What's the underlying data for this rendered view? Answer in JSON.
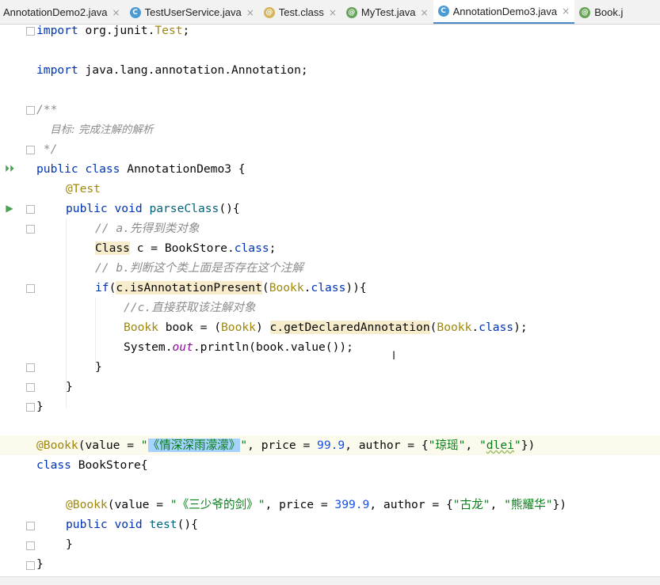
{
  "tabs": [
    {
      "label": "AnnotationDemo2.java",
      "icon": "none",
      "active": false
    },
    {
      "label": "TestUserService.java",
      "icon": "class-icon",
      "active": false
    },
    {
      "label": "Test.class",
      "icon": "annotation-icon",
      "active": false
    },
    {
      "label": "MyTest.java",
      "icon": "annotation-icon",
      "active": false
    },
    {
      "label": "AnnotationDemo3.java",
      "icon": "class-icon",
      "active": true
    },
    {
      "label": "Book.j",
      "icon": "annotation-icon",
      "active": false
    }
  ],
  "close_glyph": "×",
  "code": {
    "l1_kw": "import",
    "l1_rest": " org.junit.",
    "l1_cls": "Test",
    "l1_end": ";",
    "l3_kw": "import",
    "l3_rest": " java.lang.annotation.Annotation;",
    "l5": "/**",
    "l6": "    目标: 完成注解的解析",
    "l7": " */",
    "l8_kw": "public class",
    "l8_rest": " AnnotationDemo3 {",
    "l9": "@Test",
    "l10_kw": "public void",
    "l10_fn": " parseClass",
    "l10_end": "(){",
    "l11": "// a.先得到类对象",
    "l12_a": "Class",
    "l12_b": " c = BookStore.",
    "l12_c": "class",
    "l12_d": ";",
    "l13": "// b.判断这个类上面是否存在这个注解",
    "l14_kw": "if",
    "l14_a": "(",
    "l14_b": "c.isAnnotationPresent",
    "l14_c": "(",
    "l14_d": "Bookk",
    "l14_e": ".",
    "l14_f": "class",
    "l14_g": ")){",
    "l15": "//c.直接获取该注解对象",
    "l16_a": "Bookk",
    "l16_b": " book = (",
    "l16_c": "Bookk",
    "l16_d": ") ",
    "l16_e": "c.getDeclaredAnnotation",
    "l16_f": "(",
    "l16_g": "Bookk",
    "l16_h": ".",
    "l16_i": "class",
    "l16_j": ");",
    "l17_a": "System.",
    "l17_b": "out",
    "l17_c": ".println(book.value());",
    "l18": "}",
    "l19": "}",
    "l20": "}",
    "l22_an": "@Bookk",
    "l22_a": "(value = ",
    "l22_s1": "\"",
    "l22_sel": "《情深深雨濛濛》",
    "l22_s2": "\"",
    "l22_b": ", price = ",
    "l22_num": "99.9",
    "l22_c": ", author = {",
    "l22_s3": "\"琼瑶\"",
    "l22_d": ", ",
    "l22_s4a": "\"",
    "l22_s4b": "dlei",
    "l22_s4c": "\"",
    "l22_e": "})",
    "l23_kw": "class",
    "l23_rest": " BookStore{",
    "l25_an": "@Bookk",
    "l25_a": "(value = ",
    "l25_s1": "\"《三少爷的剑》\"",
    "l25_b": ", price = ",
    "l25_num": "399.9",
    "l25_c": ", author = {",
    "l25_s2": "\"古龙\"",
    "l25_d": ", ",
    "l25_s3": "\"熊耀华\"",
    "l25_e": "})",
    "l26_kw": "public void",
    "l26_fn": " test",
    "l26_end": "(){",
    "l27": "}",
    "l28": "}"
  },
  "gutter": {
    "run_class_glyph": "⏵⏵",
    "run_method_glyph": "▶"
  },
  "cursor_glyph": "I",
  "colors": {
    "keyword": "#0033b3",
    "comment": "#8c8c8c",
    "annotation": "#9e880d",
    "string": "#067d17",
    "number": "#1750eb",
    "selection": "#a6d2ff",
    "run_icon": "#47a152"
  }
}
